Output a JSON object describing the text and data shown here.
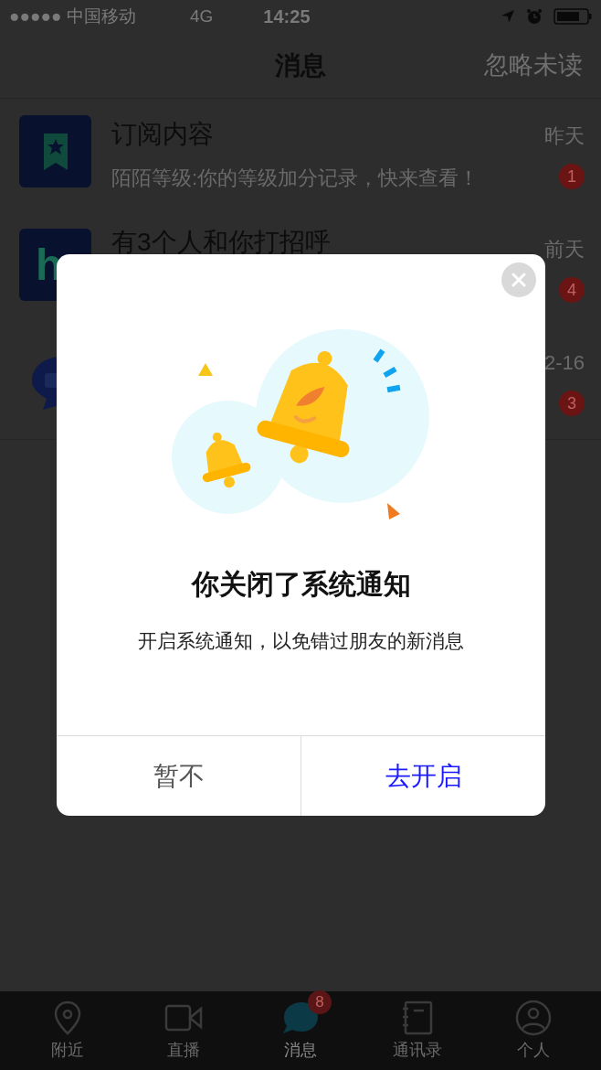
{
  "status_bar": {
    "carrier": "●●●●● 中国移动",
    "network": "4G",
    "time": "14:25"
  },
  "nav": {
    "title": "消息",
    "action": "忽略未读"
  },
  "conversations": [
    {
      "kind": "bookmark",
      "title": "订阅内容",
      "subtitle": "陌陌等级:你的等级加分记录，快来查看！",
      "time": "昨天",
      "badge": "1"
    },
    {
      "kind": "letter",
      "avatar_text": "h",
      "title": "有3个人和你打招呼",
      "time": "前天",
      "badge": "4"
    },
    {
      "kind": "chat",
      "time": "2-16",
      "badge": "3"
    }
  ],
  "dialog": {
    "title": "你关闭了系统通知",
    "message": "开启系统通知，以免错过朋友的新消息",
    "buttons": [
      {
        "label": "暂不",
        "kind": "cancel"
      },
      {
        "label": "去开启",
        "kind": "confirm"
      }
    ]
  },
  "tab_bar": [
    {
      "label": "附近",
      "selected": false
    },
    {
      "label": "直播",
      "selected": false
    },
    {
      "label": "消息",
      "selected": true,
      "badge": "8"
    },
    {
      "label": "通讯录",
      "selected": false
    },
    {
      "label": "个人",
      "selected": false
    }
  ]
}
